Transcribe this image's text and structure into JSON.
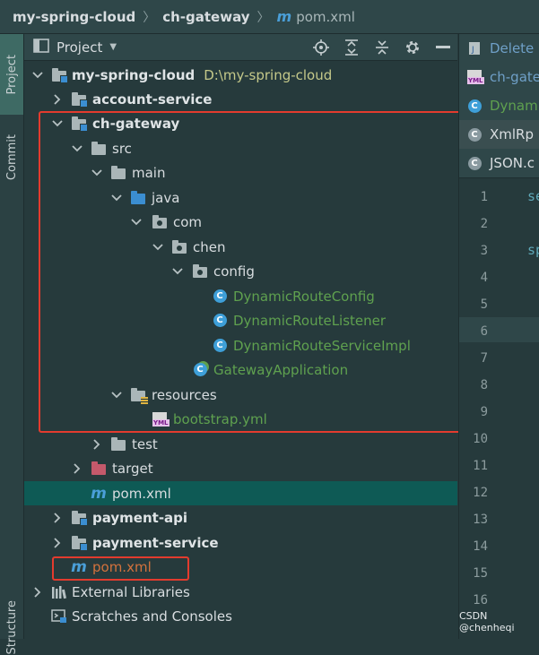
{
  "breadcrumb": {
    "items": [
      "my-spring-cloud",
      "ch-gateway"
    ],
    "file_icon": "m",
    "file": "pom.xml"
  },
  "tool_stripe": {
    "project": "Project",
    "commit": "Commit",
    "structure": "Structure"
  },
  "project_panel": {
    "title": "Project",
    "tools": [
      "locate-icon",
      "expand-all-icon",
      "collapse-all-icon",
      "gear-icon",
      "hide-icon"
    ]
  },
  "tree": {
    "root_name": "my-spring-cloud",
    "root_path": "D:\\my-spring-cloud",
    "account_service": "account-service",
    "ch_gateway": "ch-gateway",
    "src": "src",
    "main": "main",
    "java": "java",
    "com": "com",
    "chen": "chen",
    "config": "config",
    "class1": "DynamicRouteConfig",
    "class2": "DynamicRouteListener",
    "class3": "DynamicRouteServiceImpl",
    "gateway_app": "GatewayApplication",
    "resources": "resources",
    "bootstrap": "bootstrap.yml",
    "test": "test",
    "target": "target",
    "module_pom": "pom.xml",
    "payment_api": "payment-api",
    "payment_service": "payment-service",
    "root_pom": "pom.xml",
    "external_libraries": "External Libraries",
    "scratches": "Scratches and Consoles",
    "m_glyph": "m"
  },
  "editor": {
    "tabs": [
      "Delete",
      "ch-gate",
      "Dynam",
      "XmlRp",
      "JSON.c"
    ],
    "line_numbers": [
      "1",
      "2",
      "3",
      "4",
      "5",
      "6",
      "7",
      "8",
      "9",
      "10",
      "11",
      "12",
      "13",
      "14",
      "15",
      "16"
    ],
    "code_line1": "se",
    "code_line3": "sp"
  },
  "watermark": "CSDN @chenheqi",
  "colors": {
    "background": "#263a3c",
    "selected_row": "#0e5a55",
    "highlight_box": "#e33b2e",
    "class_text": "#5fa14f",
    "pom_orange": "#d3723c"
  }
}
